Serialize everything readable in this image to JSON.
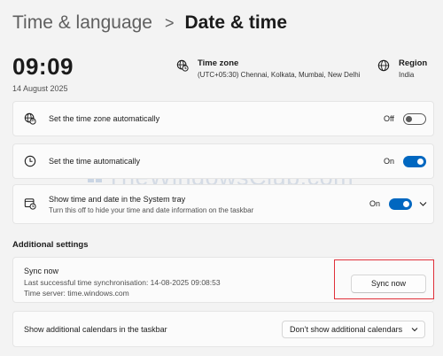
{
  "breadcrumb": {
    "parent": "Time & language",
    "separator": ">",
    "current": "Date & time"
  },
  "clock": {
    "time": "09:09",
    "date": "14 August 2025"
  },
  "time_zone": {
    "title": "Time zone",
    "value": "(UTC+05:30) Chennai, Kolkata, Mumbai, New Delhi",
    "icon": "globe-clock-icon"
  },
  "region": {
    "title": "Region",
    "value": "India",
    "icon": "globe-icon"
  },
  "settings": {
    "auto_timezone": {
      "label": "Set the time zone automatically",
      "state": "Off",
      "on": false,
      "icon": "globe-sync-icon"
    },
    "auto_time": {
      "label": "Set the time automatically",
      "state": "On",
      "on": true,
      "icon": "clock-icon"
    },
    "system_tray": {
      "label": "Show time and date in the System tray",
      "sub": "Turn this off to hide your time and date information on the taskbar",
      "state": "On",
      "on": true,
      "icon": "calendar-clock-icon"
    }
  },
  "additional": {
    "title": "Additional settings",
    "sync": {
      "title": "Sync now",
      "last_sync": "Last successful time synchronisation: 14-08-2025 09:08:53",
      "server": "Time server: time.windows.com",
      "button": "Sync now"
    },
    "calendars": {
      "label": "Show additional calendars in the taskbar",
      "selected": "Don’t show additional calendars"
    }
  },
  "watermark": "TheWindowsClub.com",
  "colors": {
    "accent": "#0067c0",
    "highlight": "#e0303a",
    "background": "#f3f3f3"
  }
}
